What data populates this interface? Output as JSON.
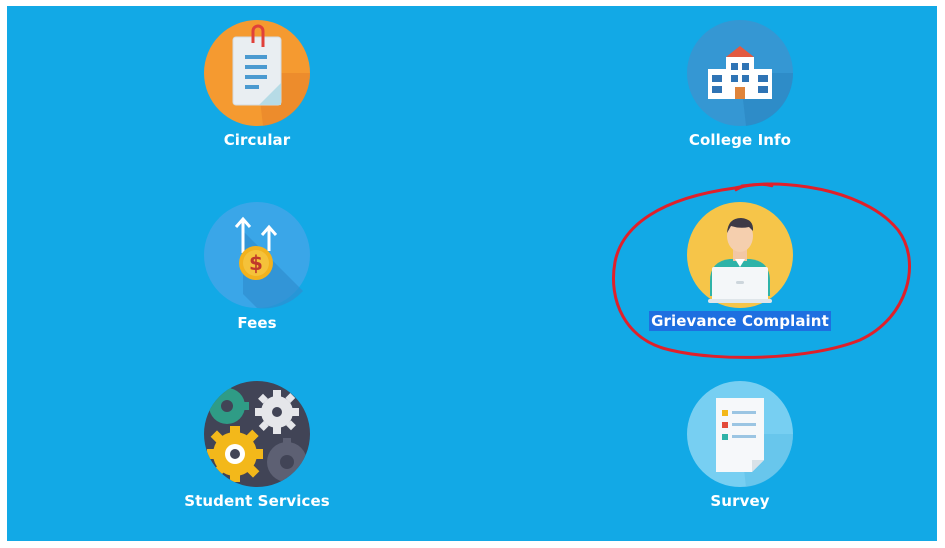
{
  "tiles": [
    {
      "label": "Circular",
      "icon": "circular-document-icon"
    },
    {
      "label": "College Info",
      "icon": "college-building-icon"
    },
    {
      "label": "Fees",
      "icon": "fees-coin-icon"
    },
    {
      "label": "Grievance Complaint",
      "icon": "grievance-person-laptop-icon"
    },
    {
      "label": "Student Services",
      "icon": "student-services-gears-icon"
    },
    {
      "label": "Survey",
      "icon": "survey-clipboard-icon"
    }
  ],
  "colors": {
    "background": "#12a9e6",
    "annotation_circle": "#e0202a",
    "text_selection": "#1e6fe0"
  }
}
